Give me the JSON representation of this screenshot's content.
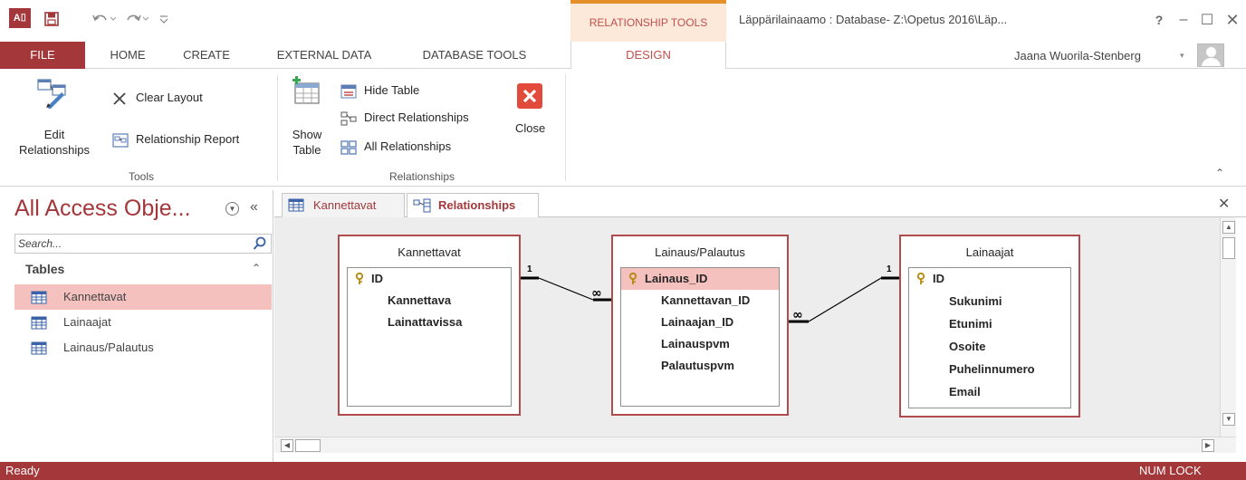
{
  "quick_access": {
    "app_icon_label": "A⌷",
    "icons": [
      "access-app-icon",
      "save-icon",
      "undo-icon",
      "redo-icon",
      "customize-qat-icon"
    ]
  },
  "title_bar": {
    "context_group": "RELATIONSHIP TOOLS",
    "window_title": "Läppärilainaamo : Database- Z:\\Opetus 2016\\Läp...",
    "help": "?",
    "minimize": "–",
    "maximize": "☐",
    "close": "✕"
  },
  "tabs": {
    "file": "FILE",
    "home": "HOME",
    "create": "CREATE",
    "external_data": "EXTERNAL DATA",
    "database_tools": "DATABASE TOOLS",
    "design": "DESIGN"
  },
  "user": {
    "name": "Jaana Wuorila-Stenberg",
    "dropdown": "▾"
  },
  "ribbon": {
    "tools": {
      "label": "Tools",
      "edit_relationships_line1": "Edit",
      "edit_relationships_line2": "Relationships",
      "clear_layout": "Clear Layout",
      "relationship_report": "Relationship Report"
    },
    "relationships": {
      "label": "Relationships",
      "show_table_line1": "Show",
      "show_table_line2": "Table",
      "hide_table": "Hide Table",
      "direct_relationships": "Direct Relationships",
      "all_relationships": "All Relationships",
      "close": "Close"
    },
    "collapse": "⌃"
  },
  "nav_pane": {
    "title": "All Access Obje...",
    "menu_glyph": "▼",
    "shutter": "«",
    "search_placeholder": "Search...",
    "section": "Tables",
    "section_collapse": "⌃",
    "items": [
      {
        "label": "Kannettavat",
        "selected": true
      },
      {
        "label": "Lainaajat",
        "selected": false
      },
      {
        "label": "Lainaus/Palautus",
        "selected": false
      }
    ]
  },
  "document_tabs": [
    {
      "label": "Kannettavat",
      "active": false
    },
    {
      "label": "Relationships",
      "active": true
    }
  ],
  "close_document": "✕",
  "relationship_tables": [
    {
      "name": "Kannettavat",
      "fields": [
        "ID",
        "Kannettava",
        "Lainattavissa"
      ],
      "primary_key": "ID",
      "selected_field": ""
    },
    {
      "name": "Lainaus/Palautus",
      "fields": [
        "Lainaus_ID",
        "Kannettavan_ID",
        "Lainaajan_ID",
        "Lainauspvm",
        "Palautuspvm"
      ],
      "primary_key": "Lainaus_ID",
      "selected_field": "Lainaus_ID"
    },
    {
      "name": "Lainaajat",
      "fields": [
        "ID",
        "Sukunimi",
        "Etunimi",
        "Osoite",
        "Puhelinnumero",
        "Email"
      ],
      "primary_key": "ID",
      "selected_field": ""
    }
  ],
  "relationships": [
    {
      "from_table": "Kannettavat",
      "from_field": "ID",
      "from_card": "1",
      "to_table": "Lainaus/Palautus",
      "to_field": "Kannettavan_ID",
      "to_card": "∞"
    },
    {
      "from_table": "Lainaajat",
      "from_field": "ID",
      "from_card": "1",
      "to_table": "Lainaus/Palautus",
      "to_field": "Lainaajan_ID",
      "to_card": "∞"
    }
  ],
  "scrollbar_glyphs": {
    "up": "▲",
    "down": "▼",
    "left": "◀",
    "right": "▶"
  },
  "status_bar": {
    "status": "Ready",
    "num_lock": "NUM LOCK"
  },
  "colors": {
    "accent": "#a4373a",
    "context_tab": "#c0504d",
    "selection": "#f4c1bf"
  }
}
